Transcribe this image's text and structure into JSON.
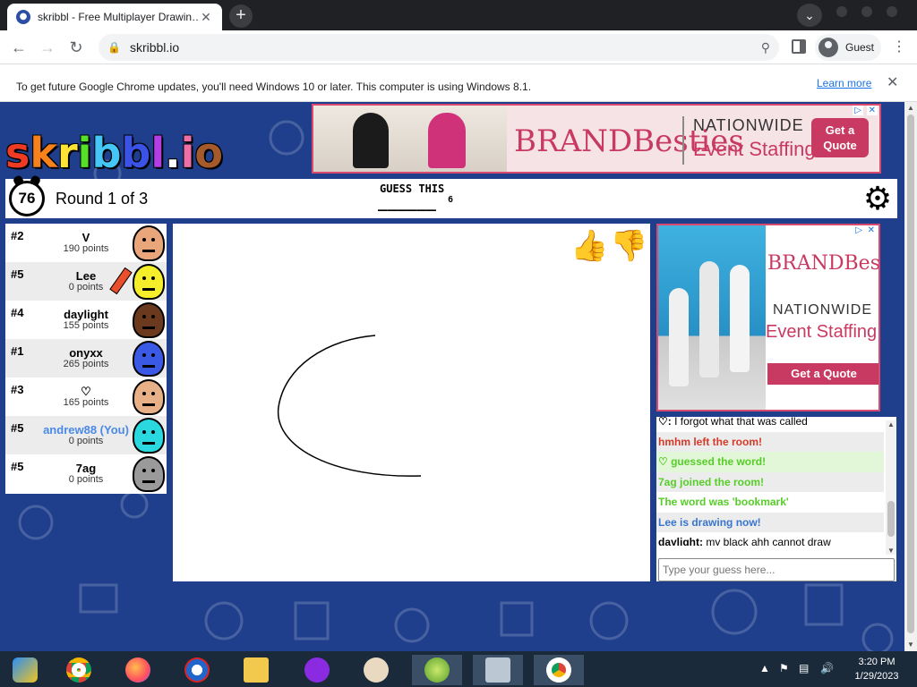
{
  "browser": {
    "tab_title": "skribbl - Free Multiplayer Drawin…",
    "tab_favicon": "skribbl-favicon-icon",
    "new_tab": "+",
    "url": "skribbl.io",
    "profile_label": "Guest"
  },
  "infobar": {
    "message": "To get future Google Chrome updates, you'll need Windows 10 or later. This computer is using Windows 8.1.",
    "link": "Learn more"
  },
  "logo": {
    "letters": [
      "s",
      "k",
      "r",
      "i",
      "b",
      "b",
      "l",
      ".",
      "i",
      "o"
    ],
    "colors": [
      "#ef3b24",
      "#f7821b",
      "#fde336",
      "#55e127",
      "#44c6f7",
      "#3a53e6",
      "#b43ee3",
      "#ffffff",
      "#ef6fa7",
      "#a55a2c"
    ]
  },
  "ad_top": {
    "brand": "BRANDBesties",
    "line1": "NATIONWIDE",
    "line2": "Event Staffing",
    "cta": "Get a Quote"
  },
  "game": {
    "timer": "76",
    "round": "Round 1 of 3",
    "guess_label": "GUESS THIS",
    "hint": "______",
    "hint_length": "6"
  },
  "players": [
    {
      "rank": "#2",
      "name": "V",
      "points": "190 points",
      "face": "#e8a67a",
      "alt": false,
      "me": false,
      "drawing": false
    },
    {
      "rank": "#5",
      "name": "Lee",
      "points": "0 points",
      "face": "#f5ee2a",
      "alt": true,
      "me": false,
      "drawing": true
    },
    {
      "rank": "#4",
      "name": "daylight",
      "points": "155 points",
      "face": "#6b3a1e",
      "alt": false,
      "me": false,
      "drawing": false
    },
    {
      "rank": "#1",
      "name": "onyxx",
      "points": "265 points",
      "face": "#3a5ae6",
      "alt": true,
      "me": false,
      "drawing": false
    },
    {
      "rank": "#3",
      "name": "♡",
      "points": "165 points",
      "face": "#e8b087",
      "alt": false,
      "me": false,
      "drawing": false
    },
    {
      "rank": "#5",
      "name": "andrew88 (You)",
      "points": "0 points",
      "face": "#2ad9e0",
      "alt": true,
      "me": true,
      "drawing": false
    },
    {
      "rank": "#5",
      "name": "7ag",
      "points": "0 points",
      "face": "#9a9a9a",
      "alt": false,
      "me": false,
      "drawing": false
    }
  ],
  "rating": {
    "like": "👍",
    "dislike": "👎"
  },
  "ad_side": {
    "brand": "BRANDBesties",
    "line1": "NATIONWIDE",
    "line2": "Event Staffing",
    "cta": "Get a Quote"
  },
  "chat": {
    "messages": [
      {
        "who": "♡:",
        "text": " I forgot what that was called",
        "style": "plain"
      },
      {
        "text": "hmhm left the room!",
        "style": "red"
      },
      {
        "text": "♡ guessed the word!",
        "style": "greenbg"
      },
      {
        "text": "7ag joined the room!",
        "style": "green"
      },
      {
        "text": "The word was 'bookmark'",
        "style": "green"
      },
      {
        "text": "Lee is drawing now!",
        "style": "blue"
      },
      {
        "who": "daylight:",
        "text": " my black ahh cannot draw",
        "style": "plain"
      }
    ],
    "input_placeholder": "Type your guess here..."
  },
  "taskbar": {
    "time": "3:20 PM",
    "date": "1/29/2023"
  }
}
